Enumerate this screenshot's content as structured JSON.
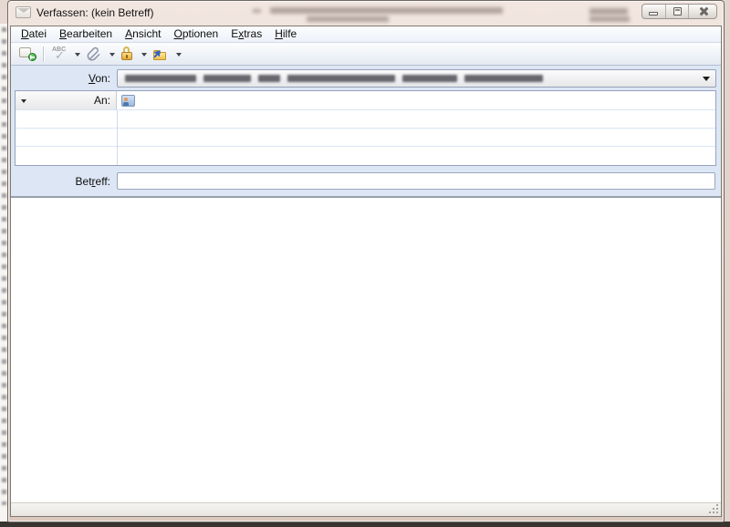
{
  "window": {
    "title": "Verfassen: (kein Betreff)"
  },
  "menu": {
    "items": [
      {
        "pre": "",
        "accel": "D",
        "post": "atei"
      },
      {
        "pre": "",
        "accel": "B",
        "post": "earbeiten"
      },
      {
        "pre": "",
        "accel": "A",
        "post": "nsicht"
      },
      {
        "pre": "",
        "accel": "O",
        "post": "ptionen"
      },
      {
        "pre": "E",
        "accel": "x",
        "post": "tras"
      },
      {
        "pre": "",
        "accel": "H",
        "post": "ilfe"
      }
    ]
  },
  "toolbar": {
    "buttons": [
      {
        "name": "send",
        "icon": "envelope-send-icon"
      },
      {
        "name": "spellcheck",
        "icon": "abc-check-icon",
        "text": "ABC",
        "check": "✓",
        "has_dropdown": true
      },
      {
        "name": "attach",
        "icon": "paperclip-icon",
        "has_dropdown": true
      },
      {
        "name": "security",
        "icon": "lock-icon",
        "has_dropdown": true
      },
      {
        "name": "save",
        "icon": "save-folder-icon",
        "has_dropdown": true
      }
    ]
  },
  "compose": {
    "from": {
      "label_pre": "",
      "label_accel": "V",
      "label_post": "on:",
      "value": ""
    },
    "to": {
      "label": "An:",
      "value": ""
    },
    "recipient_rows": 4,
    "subject": {
      "label_pre": "Bet",
      "label_accel": "r",
      "label_post": "eff:",
      "value": ""
    },
    "body_text": ""
  },
  "colors": {
    "titlebar": "#e9d9d2",
    "header_bg": "#dde6f4",
    "grid_line": "#dbe4f3",
    "window_border": "#6e6862",
    "send_green": "#2f9e2f",
    "lock_gold": "#e3a93a",
    "folder_yellow": "#efc04e"
  }
}
